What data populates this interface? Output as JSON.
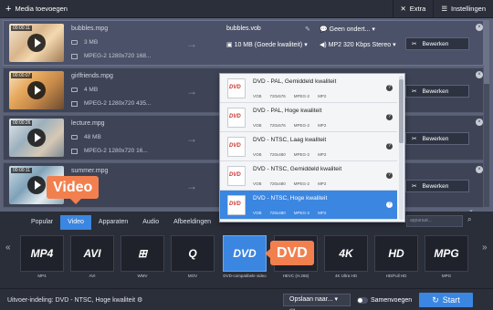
{
  "header": {
    "add_media": "Media toevoegen",
    "extra": "Extra",
    "settings": "Instellingen"
  },
  "files": [
    {
      "name": "bubbles.mpg",
      "duration": "00:00:11",
      "size": "3 MB",
      "meta": "MPEG-2 1280x720 168...",
      "out_name": "bubbles.vob",
      "subtitle": "Geen ondert...",
      "out_size": "10 MB (Goede kwaliteit)",
      "audio": "MP2 320 Kbps Stereo"
    },
    {
      "name": "girlfriends.mpg",
      "duration": "00:00:07",
      "size": "4 MB",
      "meta": "MPEG-2 1280x720 435..."
    },
    {
      "name": "lecture.mpg",
      "duration": "00:00:26",
      "size": "48 MB",
      "meta": "MPEG-2 1280x720 16..."
    },
    {
      "name": "summer.mpg",
      "duration": "00:00:11",
      "size": "",
      "meta": ""
    }
  ],
  "edit_label": "Bewerken",
  "dropdown": {
    "options": [
      {
        "name": "DVD - PAL, Gemiddeld kwaliteit",
        "specs": [
          "VOB",
          "720x576",
          "MPEG-2",
          "MP2"
        ]
      },
      {
        "name": "DVD - PAL, Hoge kwaliteit",
        "specs": [
          "VOB",
          "720x576",
          "MPEG-2",
          "MP2"
        ]
      },
      {
        "name": "DVD - NTSC, Laag kwaliteit",
        "specs": [
          "VOB",
          "720x480",
          "MPEG-2",
          "MP2"
        ]
      },
      {
        "name": "DVD - NTSC, Gemiddeld kwaliteit",
        "specs": [
          "VOB",
          "720x480",
          "MPEG-2",
          "MP2"
        ]
      },
      {
        "name": "DVD - NTSC, Hoge kwaliteit",
        "specs": [
          "VOB",
          "720x480",
          "MPEG-2",
          "MP2"
        ]
      }
    ],
    "selected_index": 4
  },
  "tabs": [
    "Popular",
    "Video",
    "Apparaten",
    "Audio",
    "Afbeeldingen"
  ],
  "active_tab": "Video",
  "search_placeholder": "apparaat...",
  "formats": [
    {
      "mark": "MP4",
      "label": "MP4"
    },
    {
      "mark": "AVI",
      "label": "AVI"
    },
    {
      "mark": "⊞",
      "label": "WMV"
    },
    {
      "mark": "Q",
      "label": "MOV"
    },
    {
      "mark": "DVD",
      "label": "DVD-compatibele video"
    },
    {
      "mark": "H",
      "label": "HEVC (H.265)"
    },
    {
      "mark": "4K",
      "label": "4K Ultra HD"
    },
    {
      "mark": "HD",
      "label": "HD/Full HD"
    },
    {
      "mark": "MPG",
      "label": "MPG"
    }
  ],
  "selected_format_index": 4,
  "callouts": {
    "video": "Video",
    "dvd": "DVD"
  },
  "footer": {
    "output_label": "Uitvoer-indeling: DVD - NTSC, Hoge kwaliteit",
    "save_label": "Opslaan naar...",
    "merge_label": "Samenvoegen",
    "start_label": "Start"
  }
}
